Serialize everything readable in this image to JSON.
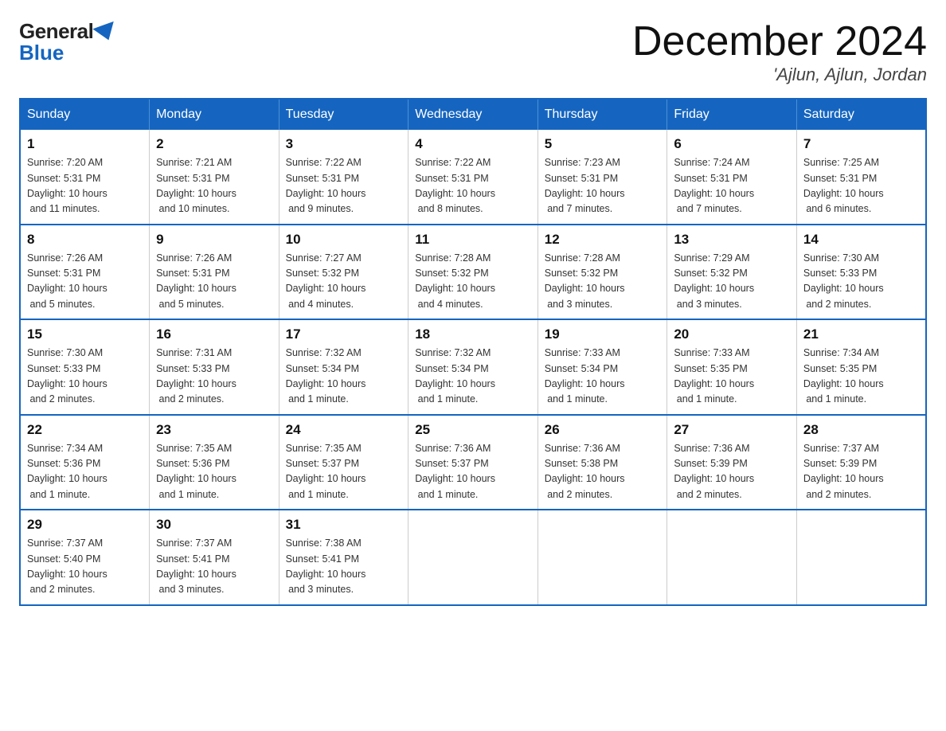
{
  "logo": {
    "general": "General",
    "blue": "Blue"
  },
  "header": {
    "month": "December 2024",
    "location": "'Ajlun, Ajlun, Jordan"
  },
  "days_of_week": [
    "Sunday",
    "Monday",
    "Tuesday",
    "Wednesday",
    "Thursday",
    "Friday",
    "Saturday"
  ],
  "weeks": [
    [
      {
        "day": "1",
        "sunrise": "7:20 AM",
        "sunset": "5:31 PM",
        "daylight": "10 hours and 11 minutes."
      },
      {
        "day": "2",
        "sunrise": "7:21 AM",
        "sunset": "5:31 PM",
        "daylight": "10 hours and 10 minutes."
      },
      {
        "day": "3",
        "sunrise": "7:22 AM",
        "sunset": "5:31 PM",
        "daylight": "10 hours and 9 minutes."
      },
      {
        "day": "4",
        "sunrise": "7:22 AM",
        "sunset": "5:31 PM",
        "daylight": "10 hours and 8 minutes."
      },
      {
        "day": "5",
        "sunrise": "7:23 AM",
        "sunset": "5:31 PM",
        "daylight": "10 hours and 7 minutes."
      },
      {
        "day": "6",
        "sunrise": "7:24 AM",
        "sunset": "5:31 PM",
        "daylight": "10 hours and 7 minutes."
      },
      {
        "day": "7",
        "sunrise": "7:25 AM",
        "sunset": "5:31 PM",
        "daylight": "10 hours and 6 minutes."
      }
    ],
    [
      {
        "day": "8",
        "sunrise": "7:26 AM",
        "sunset": "5:31 PM",
        "daylight": "10 hours and 5 minutes."
      },
      {
        "day": "9",
        "sunrise": "7:26 AM",
        "sunset": "5:31 PM",
        "daylight": "10 hours and 5 minutes."
      },
      {
        "day": "10",
        "sunrise": "7:27 AM",
        "sunset": "5:32 PM",
        "daylight": "10 hours and 4 minutes."
      },
      {
        "day": "11",
        "sunrise": "7:28 AM",
        "sunset": "5:32 PM",
        "daylight": "10 hours and 4 minutes."
      },
      {
        "day": "12",
        "sunrise": "7:28 AM",
        "sunset": "5:32 PM",
        "daylight": "10 hours and 3 minutes."
      },
      {
        "day": "13",
        "sunrise": "7:29 AM",
        "sunset": "5:32 PM",
        "daylight": "10 hours and 3 minutes."
      },
      {
        "day": "14",
        "sunrise": "7:30 AM",
        "sunset": "5:33 PM",
        "daylight": "10 hours and 2 minutes."
      }
    ],
    [
      {
        "day": "15",
        "sunrise": "7:30 AM",
        "sunset": "5:33 PM",
        "daylight": "10 hours and 2 minutes."
      },
      {
        "day": "16",
        "sunrise": "7:31 AM",
        "sunset": "5:33 PM",
        "daylight": "10 hours and 2 minutes."
      },
      {
        "day": "17",
        "sunrise": "7:32 AM",
        "sunset": "5:34 PM",
        "daylight": "10 hours and 1 minute."
      },
      {
        "day": "18",
        "sunrise": "7:32 AM",
        "sunset": "5:34 PM",
        "daylight": "10 hours and 1 minute."
      },
      {
        "day": "19",
        "sunrise": "7:33 AM",
        "sunset": "5:34 PM",
        "daylight": "10 hours and 1 minute."
      },
      {
        "day": "20",
        "sunrise": "7:33 AM",
        "sunset": "5:35 PM",
        "daylight": "10 hours and 1 minute."
      },
      {
        "day": "21",
        "sunrise": "7:34 AM",
        "sunset": "5:35 PM",
        "daylight": "10 hours and 1 minute."
      }
    ],
    [
      {
        "day": "22",
        "sunrise": "7:34 AM",
        "sunset": "5:36 PM",
        "daylight": "10 hours and 1 minute."
      },
      {
        "day": "23",
        "sunrise": "7:35 AM",
        "sunset": "5:36 PM",
        "daylight": "10 hours and 1 minute."
      },
      {
        "day": "24",
        "sunrise": "7:35 AM",
        "sunset": "5:37 PM",
        "daylight": "10 hours and 1 minute."
      },
      {
        "day": "25",
        "sunrise": "7:36 AM",
        "sunset": "5:37 PM",
        "daylight": "10 hours and 1 minute."
      },
      {
        "day": "26",
        "sunrise": "7:36 AM",
        "sunset": "5:38 PM",
        "daylight": "10 hours and 2 minutes."
      },
      {
        "day": "27",
        "sunrise": "7:36 AM",
        "sunset": "5:39 PM",
        "daylight": "10 hours and 2 minutes."
      },
      {
        "day": "28",
        "sunrise": "7:37 AM",
        "sunset": "5:39 PM",
        "daylight": "10 hours and 2 minutes."
      }
    ],
    [
      {
        "day": "29",
        "sunrise": "7:37 AM",
        "sunset": "5:40 PM",
        "daylight": "10 hours and 2 minutes."
      },
      {
        "day": "30",
        "sunrise": "7:37 AM",
        "sunset": "5:41 PM",
        "daylight": "10 hours and 3 minutes."
      },
      {
        "day": "31",
        "sunrise": "7:38 AM",
        "sunset": "5:41 PM",
        "daylight": "10 hours and 3 minutes."
      },
      null,
      null,
      null,
      null
    ]
  ],
  "labels": {
    "sunrise": "Sunrise:",
    "sunset": "Sunset:",
    "daylight": "Daylight:"
  }
}
